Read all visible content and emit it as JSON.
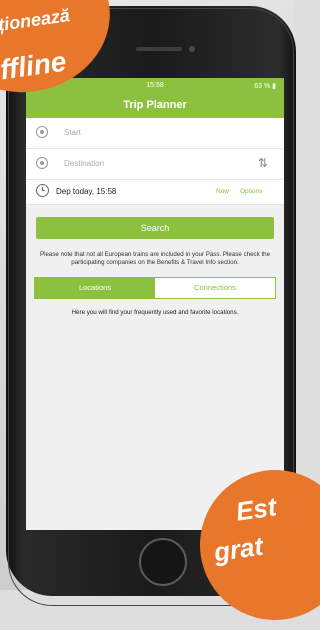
{
  "colors": {
    "accent": "#8cc13f",
    "promo": "#e8762b"
  },
  "statusbar": {
    "time": "15:58",
    "battery": "63 % ▮"
  },
  "navbar": {
    "title": "Trip Planner"
  },
  "form": {
    "start_placeholder": "Start",
    "destination_placeholder": "Destination",
    "departure": "Dep today, 15:58",
    "now_label": "Now",
    "options_label": "Options",
    "search_label": "Search"
  },
  "note": "Please note that not all European trains are included in your Pass. Please check the participating companies on the Benefits & Travel Info section.",
  "tabs": [
    {
      "label": "Locations",
      "active": true
    },
    {
      "label": "Connections",
      "active": false
    }
  ],
  "hint": "Here you will find your frequently used and favorite locations.",
  "promo": {
    "top_line1": "ționează",
    "top_line2": "ffline",
    "bottom_line1": "Est",
    "bottom_line2": "grat"
  }
}
